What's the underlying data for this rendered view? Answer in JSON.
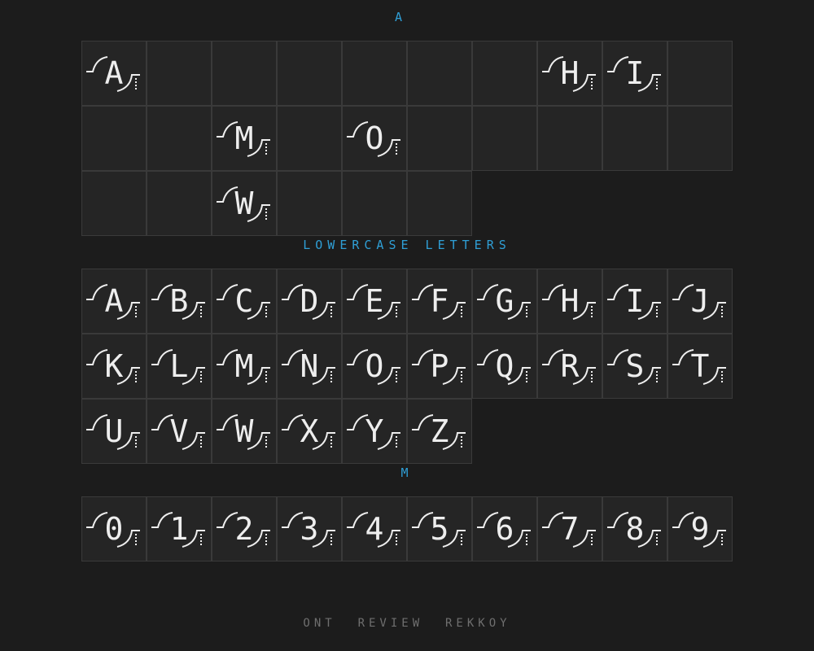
{
  "sections": {
    "uppercase_title": "A ",
    "lowercase_title": "LOWERCASE LETTERS",
    "numbers_title": "M"
  },
  "uppercase_rows": [
    [
      "A",
      "",
      "",
      "",
      "",
      "",
      "",
      "H",
      "I",
      ""
    ],
    [
      "",
      "",
      "M",
      "",
      "O",
      "",
      "",
      "",
      "",
      ""
    ],
    [
      "",
      "",
      "W",
      "",
      "",
      ""
    ]
  ],
  "lowercase_rows": [
    [
      "A",
      "B",
      "C",
      "D",
      "E",
      "F",
      "G",
      "H",
      "I",
      "J"
    ],
    [
      "K",
      "L",
      "M",
      "N",
      "O",
      "P",
      "Q",
      "R",
      "S",
      "T"
    ],
    [
      "U",
      "V",
      "W",
      "X",
      "Y",
      "Z"
    ]
  ],
  "number_rows": [
    [
      "0",
      "1",
      "2",
      "3",
      "4",
      "5",
      "6",
      "7",
      "8",
      "9"
    ]
  ],
  "footer": {
    "text": "ONT  REVIEW  REKKOY"
  },
  "colors": {
    "background": "#1c1c1c",
    "cell": "#252525",
    "grid_line": "#3a3a3a",
    "glyph": "#eeeeee",
    "title": "#2f9fd6",
    "footer": "#6f6f6f"
  }
}
